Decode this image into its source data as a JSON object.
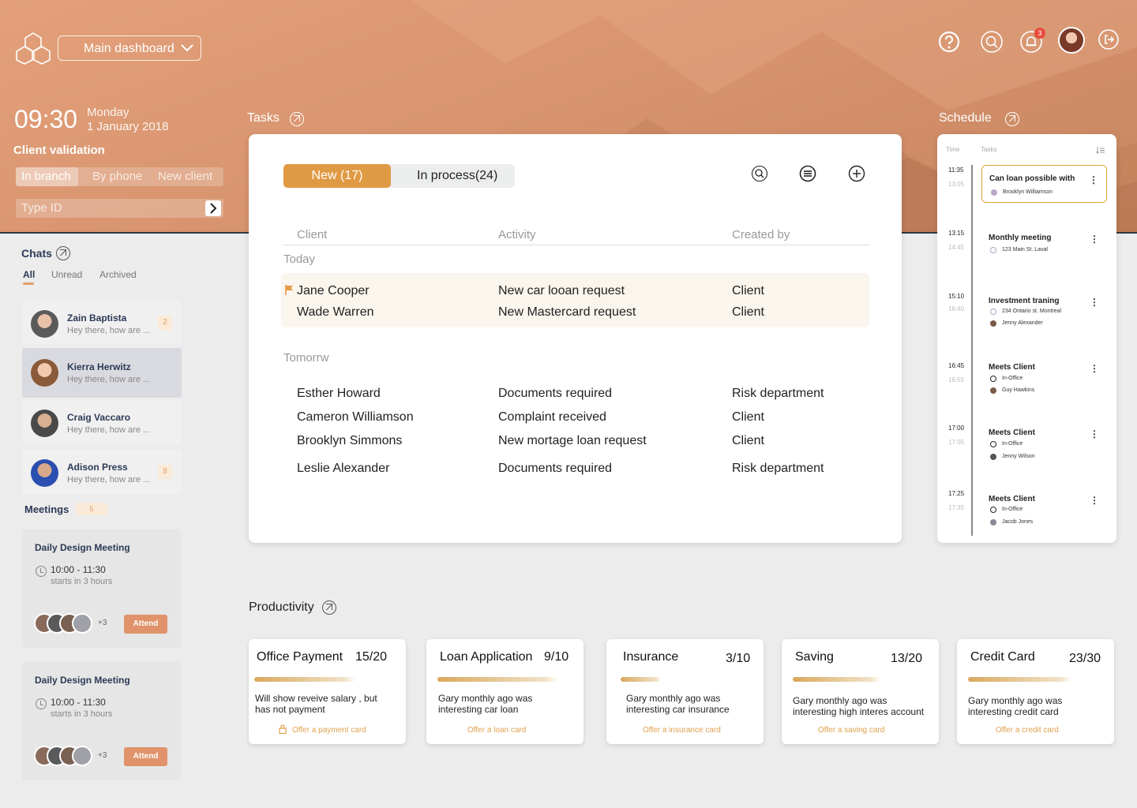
{
  "header": {
    "dashboard_select": "Main dashboard",
    "notification_count": "3",
    "icons": [
      "help-icon",
      "search-icon",
      "bell-icon",
      "logout-icon"
    ]
  },
  "clock": {
    "time": "09:30",
    "day": "Monday",
    "date": "1 January 2018"
  },
  "client_validation": {
    "title": "Client validation",
    "tabs": [
      "In branch",
      "By phone",
      "New client"
    ],
    "active_tab": "In branch",
    "placeholder": "Type ID"
  },
  "sections": {
    "tasks": "Tasks",
    "schedule": "Schedule",
    "productivity": "Productivity"
  },
  "chats": {
    "title": "Chats",
    "filters": [
      "All",
      "Unread",
      "Archived"
    ],
    "items": [
      {
        "name": "Zain Baptista",
        "message": "Hey there, how are ...",
        "count": "2"
      },
      {
        "name": "Kierra Herwitz",
        "message": "Hey there, how are ...",
        "count": ""
      },
      {
        "name": "Craig Vaccaro",
        "message": "Hey there, how are ...",
        "count": ""
      },
      {
        "name": "Adison Press",
        "message": "Hey there, how are ...",
        "count": "8"
      }
    ]
  },
  "meetings": {
    "title": "Meetings",
    "count": "5",
    "items": [
      {
        "title": "Daily Design Meeting",
        "time": "10:00 - 11:30",
        "starts": "starts in 3 hours",
        "more": "+3",
        "action": "Attend"
      },
      {
        "title": "Daily Design Meeting",
        "time": "10:00 - 11:30",
        "starts": "starts in 3 hours",
        "more": "+3",
        "action": "Attend"
      }
    ]
  },
  "tasks": {
    "tabs": {
      "new": "New (17)",
      "in_process": "In process(24)"
    },
    "columns": [
      "Client",
      "Activity",
      "Created by"
    ],
    "groups": [
      {
        "label": "Today",
        "rows": [
          {
            "client": "Jane Cooper",
            "activity": "New car looan request",
            "created_by": "Client"
          },
          {
            "client": "Wade Warren",
            "activity": "New Mastercard request",
            "created_by": "Client"
          }
        ]
      },
      {
        "label": "Tomorrw",
        "rows": [
          {
            "client": "Esther Howard",
            "activity": "Documents required",
            "created_by": "Risk department"
          },
          {
            "client": "Cameron Williamson",
            "activity": "Complaint received",
            "created_by": "Client"
          },
          {
            "client": "Brooklyn Simmons",
            "activity": "New mortage loan request",
            "created_by": "Client"
          },
          {
            "client": "Leslie Alexander",
            "activity": "Documents required",
            "created_by": "Risk department"
          }
        ]
      }
    ]
  },
  "schedule": {
    "headers": {
      "time": "Time",
      "tasks": "Tasks"
    },
    "events": [
      {
        "start": "11:35",
        "end": "13:05",
        "title": "Can loan possible with",
        "line1": "Brooklyn Williamson",
        "line2": ""
      },
      {
        "start": "13:15",
        "end": "14:45",
        "title": "Monthly meeting",
        "line1": "123 Main St. Laval",
        "line2": ""
      },
      {
        "start": "15:10",
        "end": "16:40",
        "title": "Investment traning",
        "line1": "234 Ontario st. Montreal",
        "line2": "Jenny Alexander"
      },
      {
        "start": "16:45",
        "end": "16:55",
        "title": "Meets Client",
        "line1": "In-Office",
        "line2": "Guy Hawkins"
      },
      {
        "start": "17:00",
        "end": "17:05",
        "title": "Meets Client",
        "line1": "In-Office",
        "line2": "Jenny Wilson"
      },
      {
        "start": "17:25",
        "end": "17:35",
        "title": "Meets Client",
        "line1": "In-Office",
        "line2": "Jacob Jones"
      }
    ]
  },
  "productivity": [
    {
      "title": "Office Payment",
      "value": "15/20",
      "progress": 0.75,
      "desc1": "Will show reveive salary , but",
      "desc2": "has not payment",
      "link": "Offer a payment card"
    },
    {
      "title": "Loan Application",
      "value": "9/10",
      "progress": 0.9,
      "desc1": "Gary monthly ago was",
      "desc2": "interesting car loan",
      "link": "Offer a loan card"
    },
    {
      "title": "Insurance",
      "value": "3/10",
      "progress": 0.3,
      "desc1": "Gary monthly ago was",
      "desc2": "interesting car insurance",
      "link": "Offer a insurance card"
    },
    {
      "title": "Saving",
      "value": "13/20",
      "progress": 0.65,
      "desc1": "Gary monthly ago was",
      "desc2": "interesting high interes account",
      "link": "Offer a saving card"
    },
    {
      "title": "Credit Card",
      "value": "23/30",
      "progress": 0.77,
      "desc1": "Gary monthly ago was",
      "desc2": "interesting credit card",
      "link": "Offer a credit card"
    }
  ],
  "colors": {
    "accent": "#e09a44",
    "hero": "#d9966f",
    "navy": "#2b3a55"
  }
}
